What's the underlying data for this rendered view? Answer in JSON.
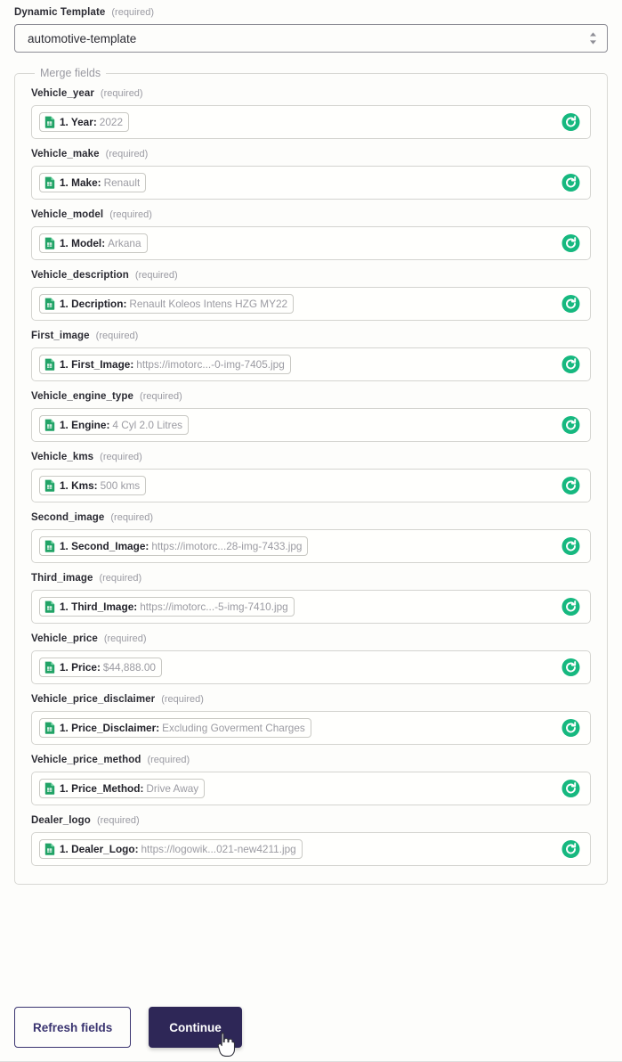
{
  "template_selector": {
    "label": "Dynamic Template",
    "required_text": "(required)",
    "selected_value": "automotive-template",
    "chevron_icon": "chevron-up-down-icon"
  },
  "merge_fields_section": {
    "legend": "Merge fields",
    "required_text": "(required)",
    "refresh_icon": "refresh-circle-icon",
    "chip_icon": "google-sheets-icon",
    "fields": [
      {
        "label": "Vehicle_year",
        "chip_key": "1. Year:",
        "chip_value": "2022"
      },
      {
        "label": "Vehicle_make",
        "chip_key": "1. Make:",
        "chip_value": "Renault"
      },
      {
        "label": "Vehicle_model",
        "chip_key": "1. Model:",
        "chip_value": "Arkana"
      },
      {
        "label": "Vehicle_description",
        "chip_key": "1. Decription:",
        "chip_value": "Renault Koleos Intens HZG MY22"
      },
      {
        "label": "First_image",
        "chip_key": "1. First_Image:",
        "chip_value": "https://imotorc...-0-img-7405.jpg"
      },
      {
        "label": "Vehicle_engine_type",
        "chip_key": "1. Engine:",
        "chip_value": "4 Cyl 2.0 Litres"
      },
      {
        "label": "Vehicle_kms",
        "chip_key": "1. Kms:",
        "chip_value": "500 kms"
      },
      {
        "label": "Second_image",
        "chip_key": "1. Second_Image:",
        "chip_value": "https://imotorc...28-img-7433.jpg"
      },
      {
        "label": "Third_image",
        "chip_key": "1. Third_Image:",
        "chip_value": "https://imotorc...-5-img-7410.jpg"
      },
      {
        "label": "Vehicle_price",
        "chip_key": "1. Price:",
        "chip_value": "$44,888.00"
      },
      {
        "label": "Vehicle_price_disclaimer",
        "chip_key": "1. Price_Disclaimer:",
        "chip_value": "Excluding Goverment Charges"
      },
      {
        "label": "Vehicle_price_method",
        "chip_key": "1. Price_Method:",
        "chip_value": "Drive Away"
      },
      {
        "label": "Dealer_logo",
        "chip_key": "1. Dealer_Logo:",
        "chip_value": "https://logowik...021-new4211.jpg"
      }
    ]
  },
  "footer": {
    "refresh_fields_label": "Refresh fields",
    "continue_label": "Continue",
    "cursor_icon": "pointing-hand-cursor"
  },
  "colors": {
    "page_background": "#fdfdfb",
    "accent_green": "#16b87f",
    "primary_button": "#2e2757",
    "secondary_button_border": "#3a3470",
    "muted_text": "#9a9aa2",
    "sheets_green": "#21a366"
  }
}
